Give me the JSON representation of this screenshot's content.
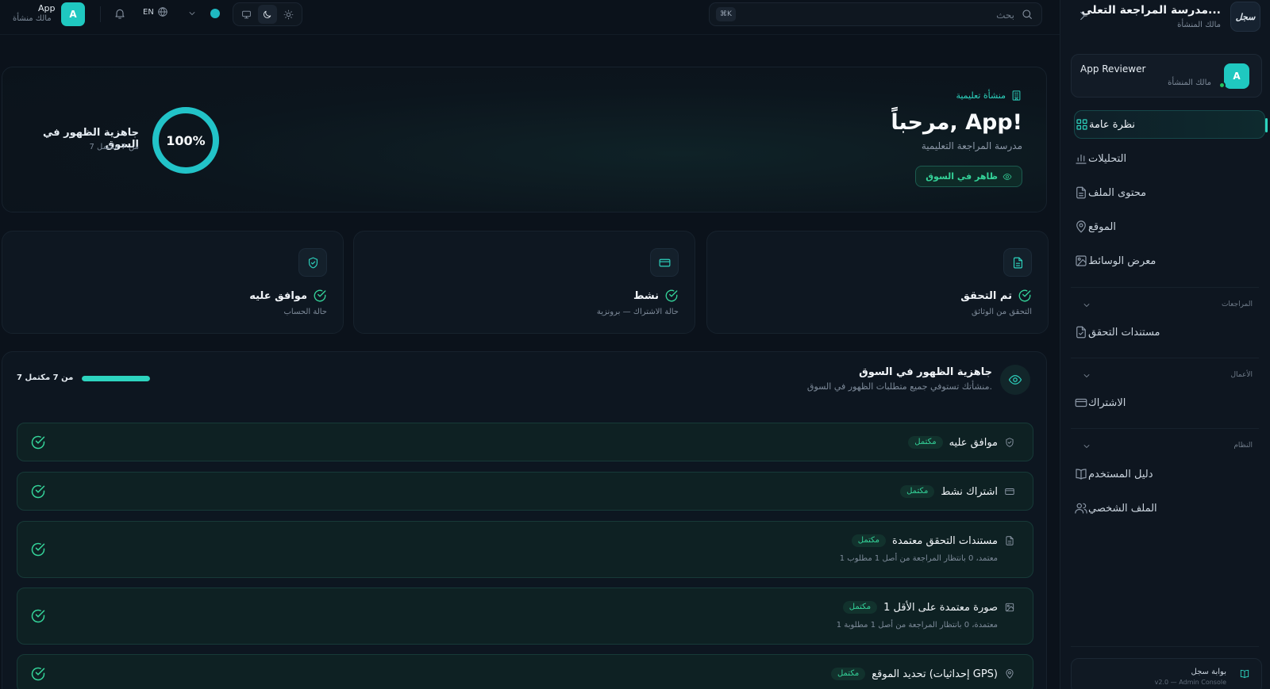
{
  "sidebar": {
    "brand_logo": "سجل",
    "brand_title": "مدرسة المراجعة التعلي...",
    "brand_sub": "مالك المنشأة",
    "user": {
      "avatar": "A",
      "name": "App Reviewer",
      "role": "مالك المنشأة"
    },
    "nav": [
      {
        "label": "نظرة عامة",
        "icon": "grid-icon",
        "active": true
      },
      {
        "label": "التحليلات",
        "icon": "bar-chart-icon"
      },
      {
        "label": "محتوى الملف",
        "icon": "file-icon"
      },
      {
        "label": "الموقع",
        "icon": "map-pin-icon"
      },
      {
        "label": "معرض الوسائط",
        "icon": "image-icon"
      }
    ],
    "sections": [
      {
        "label": "المراجعات",
        "items": [
          {
            "label": "مستندات التحقق",
            "icon": "file-check-icon"
          }
        ]
      },
      {
        "label": "الأعمال",
        "items": [
          {
            "label": "الاشتراك",
            "icon": "credit-card-icon"
          }
        ]
      },
      {
        "label": "النظام",
        "items": [
          {
            "label": "دليل المستخدم",
            "icon": "book-icon"
          },
          {
            "label": "الملف الشخصي",
            "icon": "users-icon"
          }
        ]
      }
    ],
    "portal": {
      "title": "بوابة سجل",
      "sub": "v2.0 — Admin Console"
    }
  },
  "topbar": {
    "search_placeholder": "بحث",
    "shortcut": "⌘K",
    "lang": "EN",
    "accent_color": "#1fb8c1",
    "user": {
      "avatar": "A",
      "name": "App",
      "role": "مالك منشأة"
    }
  },
  "hero": {
    "tag": "منشأة تعليمية",
    "title": "مرحباً, App!",
    "subtitle": "مدرسة المراجعة التعليمية",
    "badge": "ظاهر في السوق",
    "readiness_percent": 100,
    "readiness_label": "100%",
    "readiness_title": "جاهزية الظهور في السوق",
    "readiness_sub": "7 من 7 مكتمل"
  },
  "stats": [
    {
      "icon": "file-text-icon",
      "value": "تم التحقق",
      "caption": "التحقق من الوثائق"
    },
    {
      "icon": "credit-card-icon",
      "value": "نشط",
      "caption": "حالة الاشتراك — برونزية"
    },
    {
      "icon": "shield-check-icon",
      "value": "موافق عليه",
      "caption": "حالة الحساب"
    }
  ],
  "readiness": {
    "title": "جاهزية الظهور في السوق",
    "subtitle": "منشأتك تستوفي جميع متطلبات الظهور في السوق.",
    "count": "7 من 7 مكتمل",
    "progress": 1.0,
    "items": [
      {
        "label": "موافق عليه",
        "badge": "مكتمل",
        "icon": "shield-check-icon",
        "desc": ""
      },
      {
        "label": "اشتراك نشط",
        "badge": "مكتمل",
        "icon": "credit-card-icon",
        "desc": ""
      },
      {
        "label": "مستندات التحقق معتمدة",
        "badge": "مكتمل",
        "icon": "file-text-icon",
        "desc": "1 معتمد، 0 بانتظار المراجعة من أصل 1 مطلوب"
      },
      {
        "label": "1 صورة معتمدة على الأقل",
        "badge": "مكتمل",
        "icon": "image-icon",
        "desc": "1 معتمدة، 0 بانتظار المراجعة من أصل 1 مطلوبة"
      },
      {
        "label": "تحديد الموقع (إحداثيات GPS)",
        "badge": "مكتمل",
        "icon": "map-pin-icon",
        "desc": ""
      }
    ]
  }
}
